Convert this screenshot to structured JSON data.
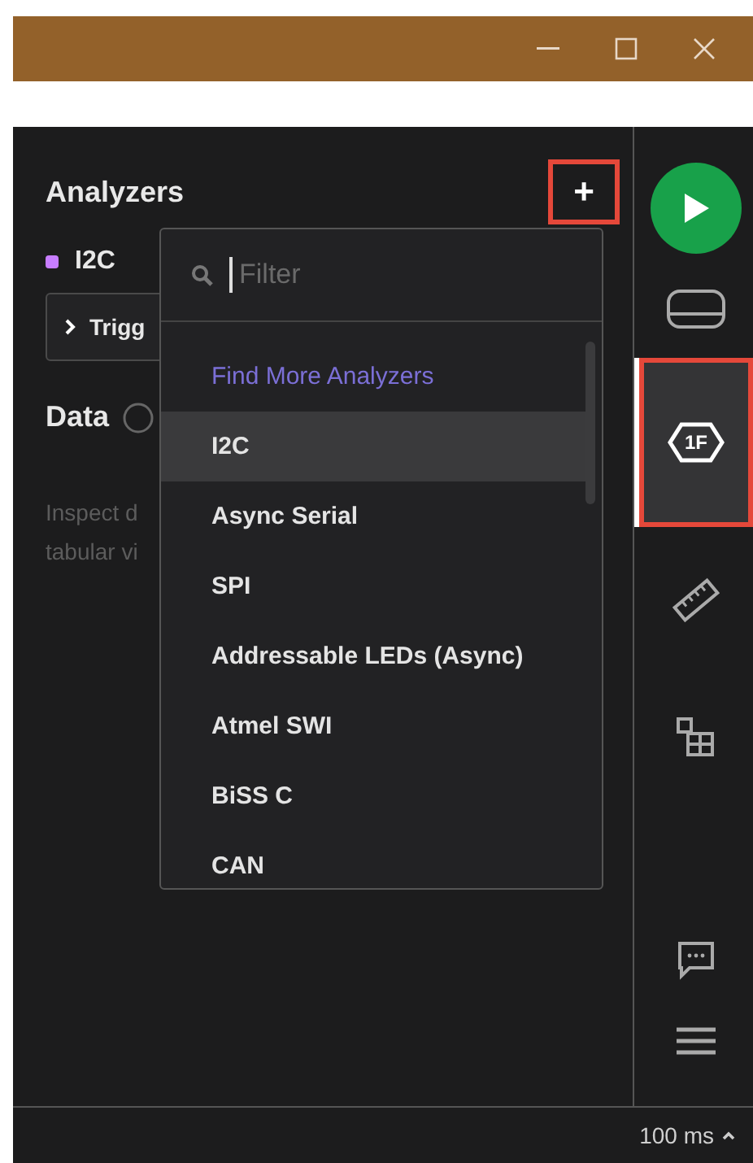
{
  "analyzers_panel": {
    "title": "Analyzers",
    "add_button": {
      "label": "+",
      "highlighted": true
    },
    "analyzers": [
      {
        "name": "I2C",
        "color": "#c77dff"
      }
    ],
    "trigger_button": {
      "label": "Trigg"
    },
    "data_section": {
      "title": "Data",
      "description": [
        "Inspect d",
        "tabular vi"
      ]
    }
  },
  "dropdown": {
    "filter": {
      "placeholder": "Filter"
    },
    "items": [
      {
        "kind": "link",
        "label": "Find More Analyzers",
        "selected": false
      },
      {
        "kind": "option",
        "label": "I2C",
        "selected": true
      },
      {
        "kind": "option",
        "label": "Async Serial",
        "selected": false
      },
      {
        "kind": "option",
        "label": "SPI",
        "selected": false
      },
      {
        "kind": "option",
        "label": "Addressable LEDs (Async)",
        "selected": false
      },
      {
        "kind": "option",
        "label": "Atmel SWI",
        "selected": false
      },
      {
        "kind": "option",
        "label": "BiSS C",
        "selected": false
      },
      {
        "kind": "option",
        "label": "CAN",
        "selected": false
      }
    ]
  },
  "rail": [
    {
      "kind": "play",
      "selected": false,
      "highlighted": false
    },
    {
      "kind": "device",
      "selected": false,
      "highlighted": false
    },
    {
      "kind": "trigger",
      "label": "1F",
      "selected": true,
      "highlighted": true
    },
    {
      "kind": "ruler",
      "selected": false,
      "highlighted": false
    },
    {
      "kind": "layout",
      "selected": false,
      "highlighted": false
    },
    {
      "kind": "spacer"
    },
    {
      "kind": "chat",
      "selected": false,
      "highlighted": false
    },
    {
      "kind": "menu",
      "selected": false,
      "highlighted": false
    }
  ],
  "status_bar": {
    "time_scale": "100 ms"
  }
}
